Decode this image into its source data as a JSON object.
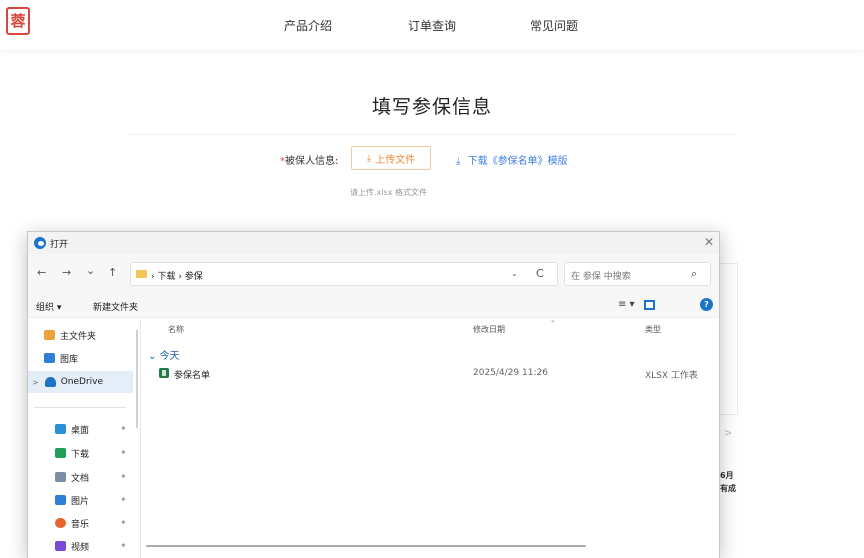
{
  "header": {
    "logo_text": "蓉",
    "nav": [
      "产品介绍",
      "订单查询",
      "常见问题"
    ]
  },
  "form": {
    "title": "填写参保信息",
    "required_mark": "*",
    "insured_label": "被保人信息:",
    "upload_icon": "⤓",
    "upload_label": "上传文件",
    "download_label": "下载《参保名单》模版",
    "hint": "请上传.xlsx 格式文件"
  },
  "background_fragments": {
    "chevron": ">",
    "text1": "6月",
    "text2": "有成"
  },
  "dialog": {
    "title": "打开",
    "close": "✕",
    "nav_buttons": [
      "←",
      "→",
      "⌄",
      "↑"
    ],
    "breadcrumb": "› 下载 › 参保",
    "address_dropdown": "⌄",
    "refresh": "C",
    "search_placeholder": "在 参保 中搜索",
    "search_icon": "⌕",
    "toolbar": {
      "organize": "组织 ▾",
      "new_folder": "新建文件夹",
      "view": "≡ ▾",
      "help": "?"
    },
    "sidebar": [
      {
        "label": "主文件夹",
        "icon": "home-icon",
        "color": "#e8a33d",
        "pinned": false
      },
      {
        "label": "图库",
        "icon": "gallery-icon",
        "color": "#2f7ed8",
        "pinned": false
      },
      {
        "label": "OneDrive",
        "icon": "cloud-icon",
        "color": "#1b74c9",
        "pinned": false,
        "selected": true,
        "expander": ">"
      },
      {
        "label": "桌面",
        "icon": "desktop-icon",
        "color": "#2b8fd8",
        "pinned": true
      },
      {
        "label": "下载",
        "icon": "download-icon",
        "color": "#1f9f5a",
        "pinned": true
      },
      {
        "label": "文档",
        "icon": "document-icon",
        "color": "#7b8fa8",
        "pinned": true
      },
      {
        "label": "图片",
        "icon": "pictures-icon",
        "color": "#2f7ed8",
        "pinned": true
      },
      {
        "label": "音乐",
        "icon": "music-icon",
        "color": "#e8642d",
        "pinned": true
      },
      {
        "label": "视频",
        "icon": "video-icon",
        "color": "#7b4ad8",
        "pinned": true
      }
    ],
    "pin_glyph": "✦",
    "columns": {
      "name": "名称",
      "modified": "修改日期",
      "type": "类型",
      "sort_indicator": "⌄"
    },
    "group_label": "⌄ 今天",
    "files": [
      {
        "name": "参保名单",
        "modified": "2025/4/29 11:26",
        "type": "XLSX 工作表",
        "icon": "excel-file-icon"
      }
    ]
  }
}
